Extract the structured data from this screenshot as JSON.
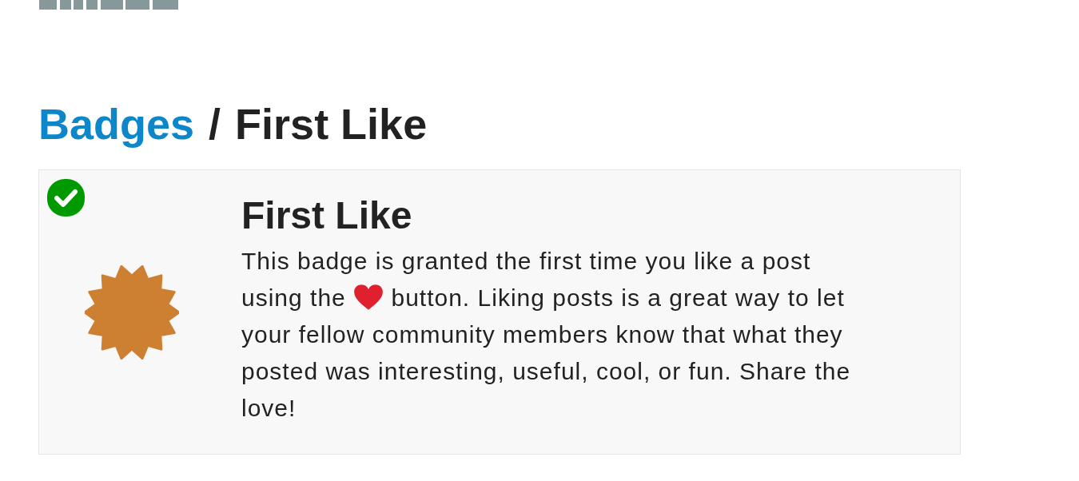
{
  "breadcrumb": {
    "items": [
      {
        "label": "Badges",
        "kind": "link"
      },
      {
        "label": "First Like",
        "kind": "current"
      }
    ],
    "separator": "/"
  },
  "badge": {
    "title": "First Like",
    "granted": true,
    "description_before_icon": "This badge is granted the first time you like a post using the",
    "description_after_icon": "button. Liking posts is a great way to let your fellow community members know that what they posted was interesting, useful, cool, or fun. Share the love!"
  }
}
